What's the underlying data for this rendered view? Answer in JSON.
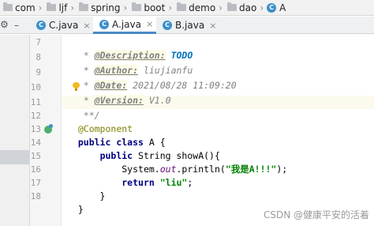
{
  "breadcrumb": {
    "items": [
      "com",
      "ljf",
      "spring",
      "boot",
      "demo",
      "dao",
      "A"
    ]
  },
  "tabs": [
    {
      "label": "C.java",
      "active": false
    },
    {
      "label": "A.java",
      "active": true
    },
    {
      "label": "B.java",
      "active": false
    }
  ],
  "gutter": {
    "line_numbers": [
      "7",
      "8",
      "9",
      "10",
      "11",
      "12",
      "13",
      "14",
      "15",
      "16",
      "17",
      "18"
    ]
  },
  "code": {
    "l7_star": " * ",
    "l7_tag": "@Description:",
    "l7_todo": " TODO",
    "l8_star": " * ",
    "l8_tag": "@Author:",
    "l8_val": " liujianfu",
    "l9_star": " * ",
    "l9_tag": "@Date:",
    "l9_val": " 2021/08/28 11:09:20",
    "l10_star": " * ",
    "l10_tag": "@Version:",
    "l10_val": " V1.0",
    "l11": " **/",
    "l12": "@Component",
    "l13_kw": "public class",
    "l13_rest": " A {",
    "l14_indent": "    ",
    "l14_kw": "public",
    "l14_rest": " String showA(){",
    "l15_indent": "        ",
    "l15_a": "System.",
    "l15_field": "out",
    "l15_b": ".println(",
    "l15_str": "\"我是A!!!\"",
    "l15_c": ");",
    "l16_indent": "        ",
    "l16_kw": "return",
    "l16_sp": " ",
    "l16_str": "\"liu\"",
    "l16_end": ";",
    "l17": "    }",
    "l18": "}"
  },
  "icons": {
    "crumb_folder": "folder-icon",
    "class": "class-c-icon",
    "gear": "gear-icon",
    "bulb": "lightbulb-icon",
    "bean": "spring-bean-icon"
  },
  "colors": {
    "accent": "#4a88c7",
    "class_icon": "#3d8fcb",
    "keyword": "#000080",
    "string": "#008000",
    "annotation": "#808000",
    "comment": "#808080",
    "todo": "#0073bf"
  },
  "watermark": "CSDN @健康平安的活着"
}
